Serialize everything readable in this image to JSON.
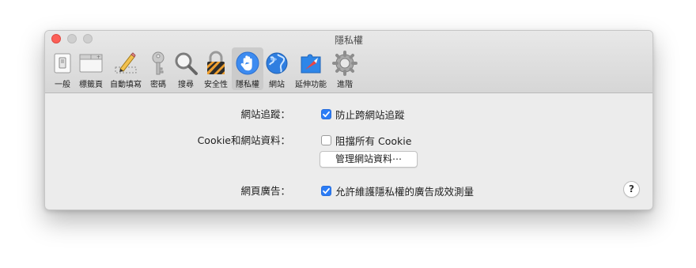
{
  "window": {
    "title": "隱私權"
  },
  "toolbar": {
    "items": [
      {
        "label": "一般",
        "icon": "general-switch-icon"
      },
      {
        "label": "標籤頁",
        "icon": "tabs-icon"
      },
      {
        "label": "自動填寫",
        "icon": "autofill-pencil-icon"
      },
      {
        "label": "密碼",
        "icon": "key-icon"
      },
      {
        "label": "搜尋",
        "icon": "magnifier-icon"
      },
      {
        "label": "安全性",
        "icon": "padlock-icon"
      },
      {
        "label": "隱私權",
        "icon": "privacy-hand-icon",
        "selected": true
      },
      {
        "label": "網站",
        "icon": "globe-icon"
      },
      {
        "label": "延伸功能",
        "icon": "extensions-compass-icon"
      },
      {
        "label": "進階",
        "icon": "gear-icon"
      }
    ]
  },
  "privacy": {
    "tracking": {
      "label": "網站追蹤：",
      "option": "防止跨網站追蹤",
      "checked": true
    },
    "cookies": {
      "label": "Cookie和網站資料：",
      "option": "阻擋所有 Cookie",
      "checked": false,
      "button": "管理網站資料⋯"
    },
    "ads": {
      "label": "網頁廣告：",
      "option": "允許維護隱私權的廣告成效測量",
      "checked": true
    }
  },
  "help": {
    "label": "?"
  },
  "colors": {
    "accent": "#2b7cf6",
    "close": "#fc5f57"
  }
}
